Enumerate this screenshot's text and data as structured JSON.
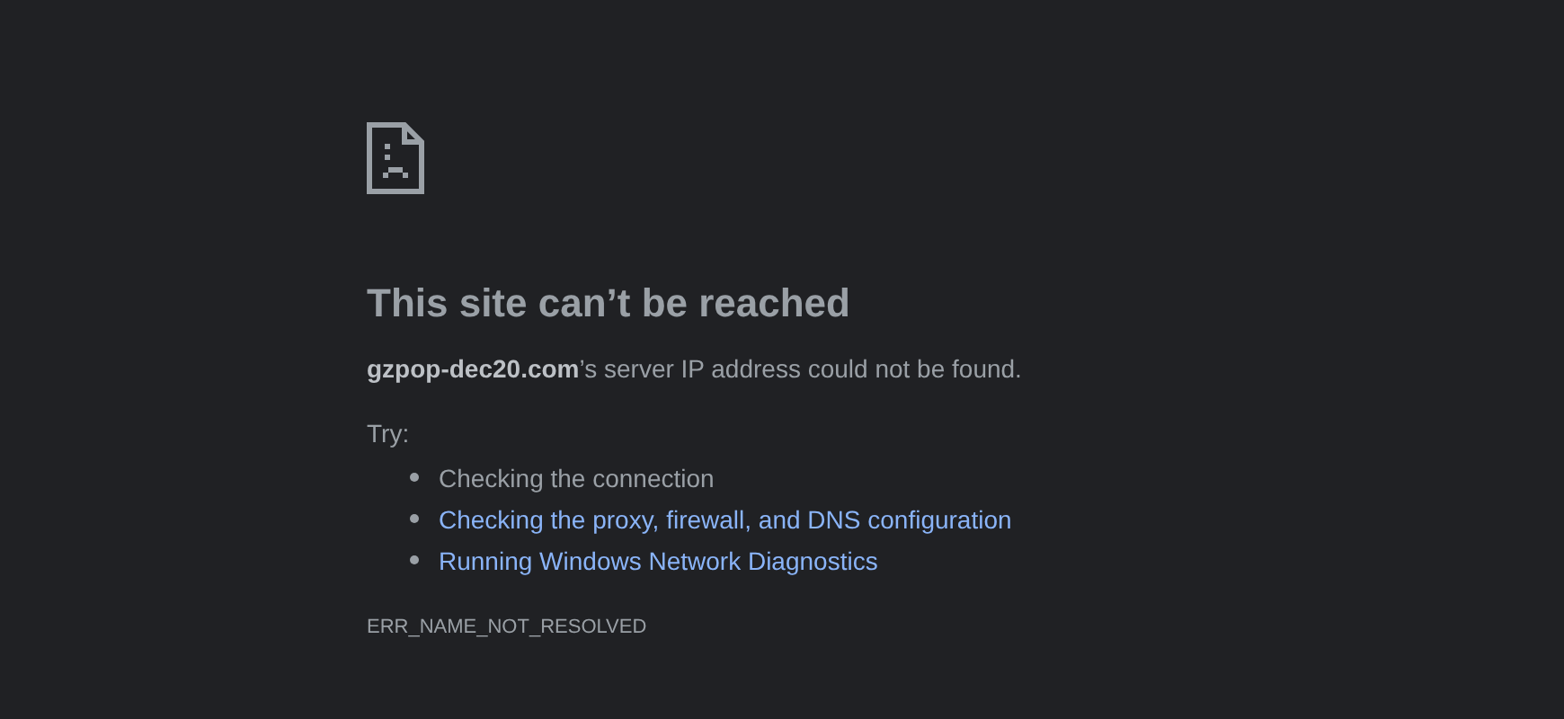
{
  "heading": "This site can’t be reached",
  "message": "**gzpop-dec20.com**’s server IP address could not be found.",
  "suggestions_label": "Try:",
  "suggestions": [
    {
      "kind": "text",
      "label": "Checking the connection"
    },
    {
      "kind": "link",
      "label": "Checking the proxy, firewall, and DNS configuration"
    },
    {
      "kind": "link",
      "label": "Running Windows Network Diagnostics"
    }
  ],
  "error_code": "ERR_NAME_NOT_RESOLVED"
}
